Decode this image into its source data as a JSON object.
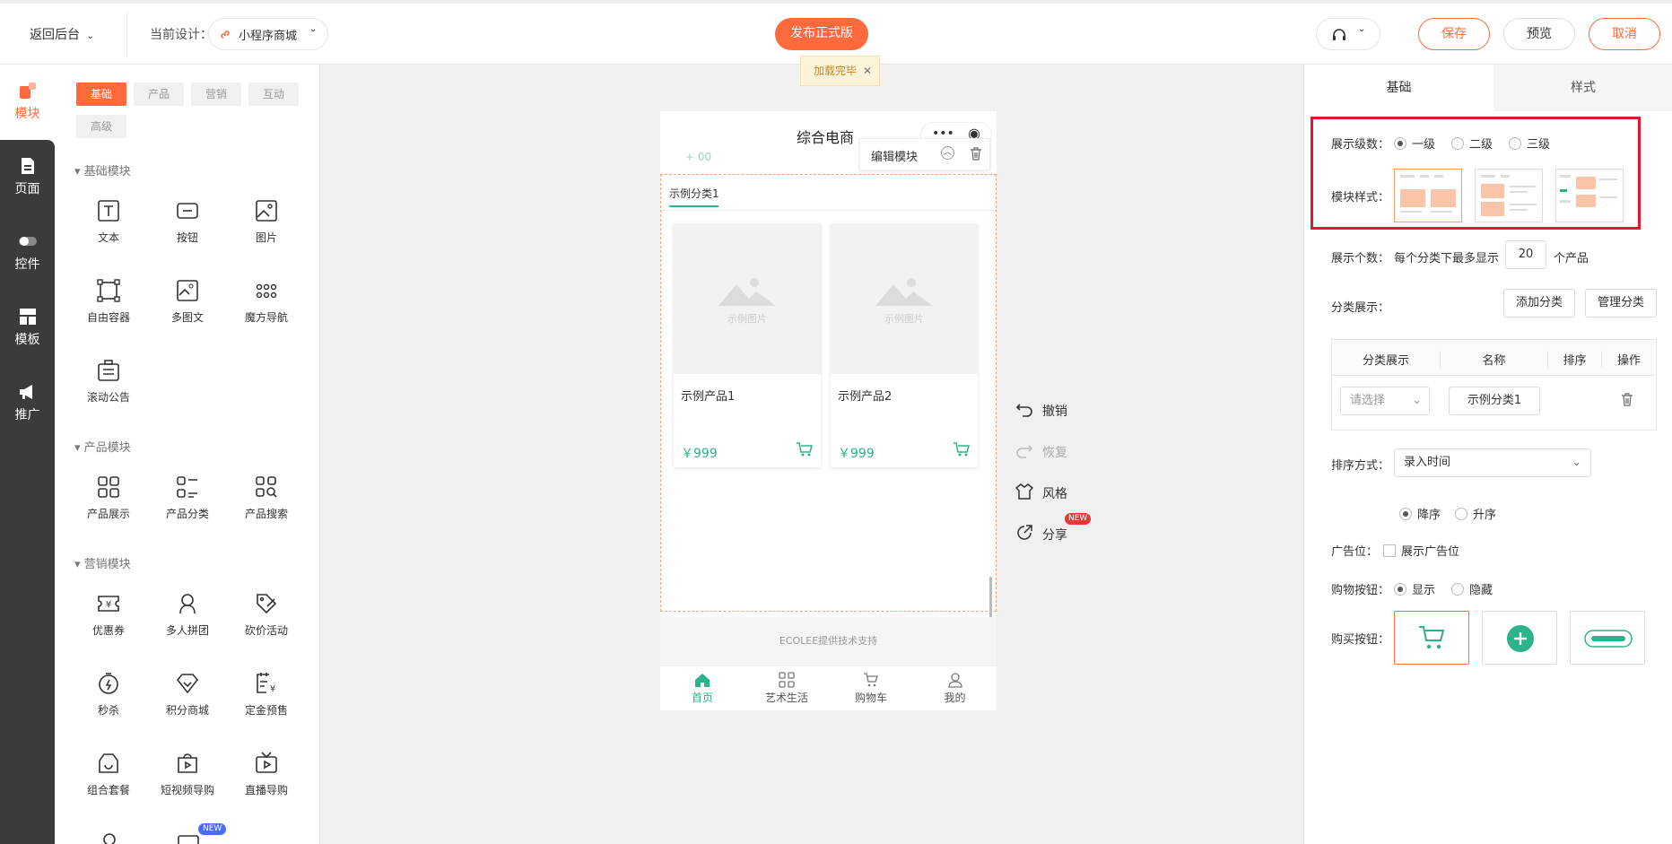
{
  "topbar": {
    "back_label": "返回后台",
    "current_design_label": "当前设计：",
    "design_name": "小程序商城",
    "publish_label": "发布正式版",
    "save_label": "保存",
    "preview_label": "预览",
    "cancel_label": "取消",
    "toast": "加载完毕",
    "accent_color": "#ff6a3d"
  },
  "leftnav": {
    "items": [
      {
        "label": "模块",
        "icon": "blocks-icon"
      },
      {
        "label": "页面",
        "icon": "page-icon"
      },
      {
        "label": "控件",
        "icon": "toggle-icon"
      },
      {
        "label": "模板",
        "icon": "template-icon"
      },
      {
        "label": "推广",
        "icon": "megaphone-icon"
      }
    ]
  },
  "modpanel": {
    "tabs": [
      "基础",
      "产品",
      "营销",
      "互动",
      "高级"
    ],
    "sections": [
      {
        "title": "基础模块",
        "items": [
          "文本",
          "按钮",
          "图片",
          "自由容器",
          "多图文",
          "魔方导航",
          "滚动公告"
        ]
      },
      {
        "title": "产品模块",
        "items": [
          "产品展示",
          "产品分类",
          "产品搜索"
        ]
      },
      {
        "title": "营销模块",
        "items": [
          "优惠券",
          "多人拼团",
          "砍价活动",
          "秒杀",
          "积分商城",
          "定金预售",
          "组合套餐",
          "短视频导购",
          "直播导购"
        ]
      }
    ],
    "new_badge": "NEW"
  },
  "phone": {
    "title": "综合电商",
    "edit_module": "编辑模块",
    "category_tab": "示例分类1",
    "placeholder_text": "示例图片",
    "products": [
      {
        "name": "示例产品1",
        "price": "￥999"
      },
      {
        "name": "示例产品2",
        "price": "￥999"
      }
    ],
    "footer": "ECOLEE提供技术支持",
    "tabbar": [
      "首页",
      "艺术生活",
      "购物车",
      "我的"
    ]
  },
  "side_actions": {
    "undo": "撤销",
    "redo": "恢复",
    "style": "风格",
    "share": "分享",
    "new_badge": "NEW"
  },
  "rightpanel": {
    "tabs": [
      "基础",
      "样式"
    ],
    "level_label": "展示级数：",
    "levels": [
      "一级",
      "二级",
      "三级"
    ],
    "module_style_label": "模块样式：",
    "count_label": "展示个数：",
    "count_prefix": "每个分类下最多显示",
    "count_value": "20",
    "count_suffix": "个产品",
    "category_label": "分类展示：",
    "add_category": "添加分类",
    "manage_category": "管理分类",
    "table_headers": [
      "分类展示",
      "名称",
      "排序",
      "操作"
    ],
    "row_select": "请选择",
    "row_name": "示例分类1",
    "sort_label": "排序方式：",
    "sort_value": "录入时间",
    "order_desc": "降序",
    "order_asc": "升序",
    "ad_label": "广告位：",
    "ad_checkbox": "展示广告位",
    "cart_btn_label": "购物按钮：",
    "cart_show": "显示",
    "cart_hide": "隐藏",
    "buy_btn_label": "购买按钮："
  }
}
